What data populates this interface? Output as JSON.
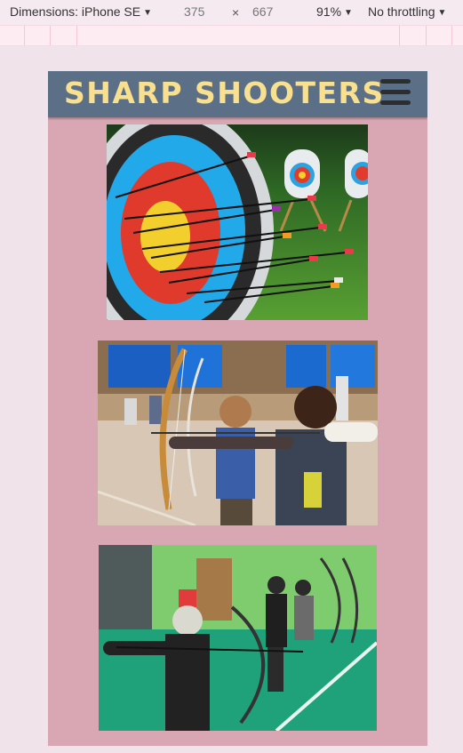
{
  "devtools": {
    "device_label": "Dimensions: iPhone SE",
    "width": "375",
    "times": "×",
    "height": "667",
    "zoom": "91%",
    "throttling": "No throttling",
    "caret": "▼"
  },
  "site": {
    "title": "SHARP SHOOTERS",
    "header_bg": "#5b7086",
    "title_color": "#f9e08f",
    "page_bg": "#d9a7b3"
  },
  "gallery": [
    {
      "name": "archery-target-arrows"
    },
    {
      "name": "kids-drawing-bows"
    },
    {
      "name": "indoor-archery-hall"
    }
  ]
}
